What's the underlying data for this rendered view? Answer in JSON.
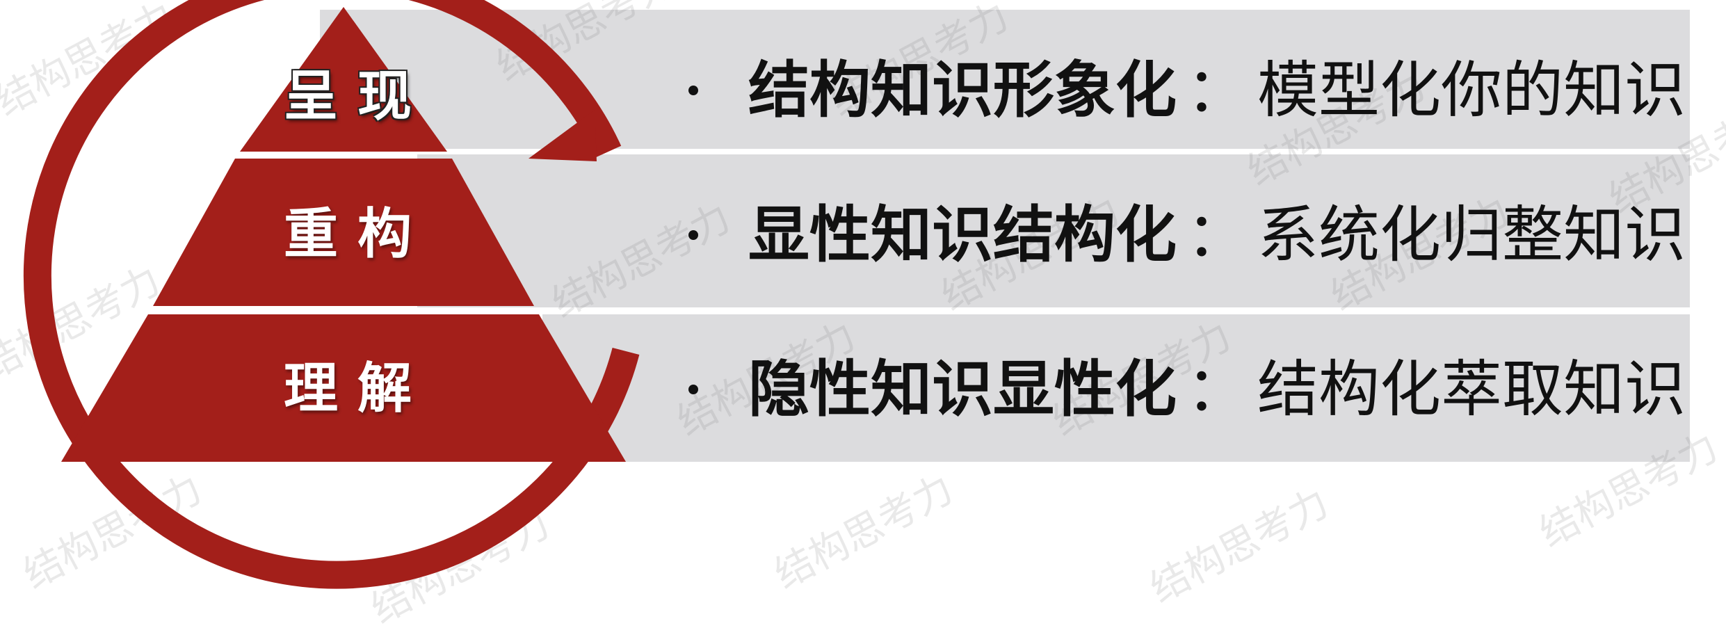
{
  "pyramid": {
    "levels": [
      {
        "id": "top",
        "label": "呈现"
      },
      {
        "id": "middle",
        "label": "重构"
      },
      {
        "id": "bottom",
        "label": "理解"
      }
    ]
  },
  "rows": [
    {
      "bullet": "•",
      "title": "结构知识形象化",
      "separator": "：",
      "detail": "模型化你的知识"
    },
    {
      "bullet": "•",
      "title": "显性知识结构化",
      "separator": "：",
      "detail": "系统化归整知识"
    },
    {
      "bullet": "•",
      "title": "隐性知识显性化",
      "separator": "：",
      "detail": "结构化萃取知识"
    }
  ],
  "watermark": {
    "text": "结构思考力"
  },
  "colors": {
    "pyramid_red": "#a31f1a",
    "band_gray": "#dcdcde",
    "text_dark": "#111111",
    "label_white": "#ffffff"
  },
  "icons": {
    "cycle_arrow": "circular-arrow-icon"
  }
}
